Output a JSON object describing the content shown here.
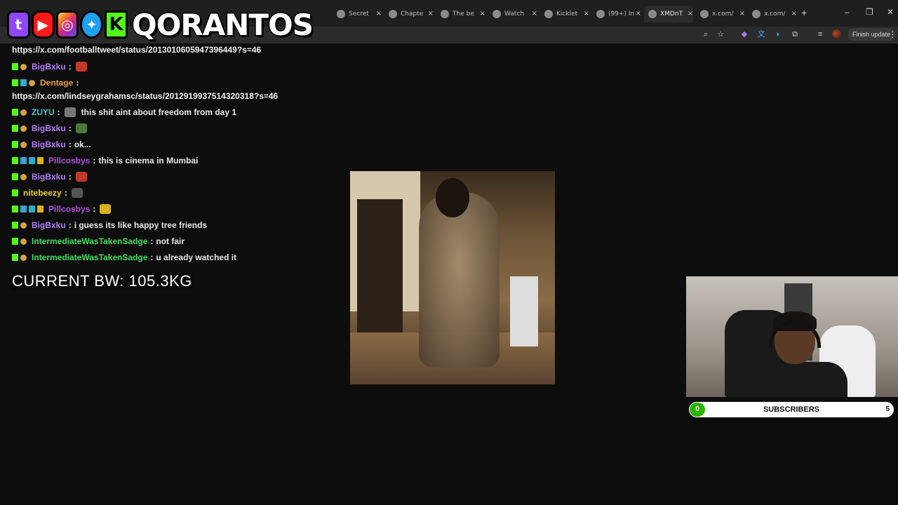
{
  "browser": {
    "tabs": [
      {
        "label": "Secret",
        "icon": "globe-icon"
      },
      {
        "label": "Chapte",
        "icon": "book-icon"
      },
      {
        "label": "The be",
        "icon": "github-icon"
      },
      {
        "label": "Watch",
        "icon": "play-icon"
      },
      {
        "label": "Kicklet",
        "icon": "kick-icon"
      },
      {
        "label": "(99+) In",
        "icon": "tiktok-icon"
      },
      {
        "label": "XMDnT",
        "icon": "frog-icon",
        "active": true
      },
      {
        "label": "x.com/",
        "icon": "x-icon"
      },
      {
        "label": "x.com/",
        "icon": "x-icon"
      }
    ],
    "new_tab": "+",
    "finish_update": "Finish update"
  },
  "overlay": {
    "brand": "QORANTOS",
    "socials": [
      "twitch",
      "youtube",
      "instagram",
      "twitter",
      "kick"
    ]
  },
  "chat": {
    "top_link": "https://x.com/footballtweet/status/2013010605947396449?s=46",
    "lines": [
      {
        "badges": [
          "kick",
          "hand"
        ],
        "user": "BigBxku",
        "color": "#b37ff5",
        "text": "",
        "emote": "#c0392b"
      },
      {
        "badges": [
          "kick",
          "cube",
          "hand"
        ],
        "user": "Dentage",
        "color": "#e8a33a",
        "text": "",
        "emote": ""
      },
      {
        "badges": [
          "kick",
          "hand"
        ],
        "user": "ZUYU",
        "color": "#40c8d0",
        "text": "this shit aint about freedom from day 1",
        "emote": "#777777"
      },
      {
        "badges": [
          "kick",
          "hand"
        ],
        "user": "BigBxku",
        "color": "#b37ff5",
        "text": "",
        "emote": "#4a7a3a"
      },
      {
        "badges": [
          "kick",
          "hand"
        ],
        "user": "BigBxku",
        "color": "#b37ff5",
        "text": "ok...",
        "emote": ""
      },
      {
        "badges": [
          "kick",
          "blue",
          "cube",
          "gold"
        ],
        "user": "Pillcosbys",
        "color": "#b050e0",
        "text": "this is cinema in Mumbai",
        "emote": ""
      },
      {
        "badges": [
          "kick",
          "hand"
        ],
        "user": "BigBxku",
        "color": "#b37ff5",
        "text": "",
        "emote": "#c0392b"
      },
      {
        "badges": [
          "kick"
        ],
        "user": "nitebeezy",
        "color": "#e8d030",
        "text": "",
        "emote": "#555555"
      },
      {
        "badges": [
          "kick",
          "blue",
          "cube",
          "gold"
        ],
        "user": "Pillcosbys",
        "color": "#b050e0",
        "text": "",
        "emote": "#d8b020"
      },
      {
        "badges": [
          "kick",
          "hand"
        ],
        "user": "BigBxku",
        "color": "#b37ff5",
        "text": "i guess its like happy tree friends",
        "emote": ""
      },
      {
        "badges": [
          "kick",
          "hand"
        ],
        "user": "IntermediateWasTakenSadge",
        "color": "#3ee060",
        "text": "not fair",
        "emote": ""
      },
      {
        "badges": [
          "kick",
          "hand"
        ],
        "user": "IntermediateWasTakenSadge",
        "color": "#3ee060",
        "text": "u already watched it",
        "emote": ""
      }
    ],
    "link_after_dentage": "https://x.com/lindseygrahamsc/status/2012919937514320318?s=46"
  },
  "body_weight": "CURRENT BW: 105.3KG",
  "subscribers": {
    "current": "0",
    "label": "SUBSCRIBERS",
    "goal": "5",
    "progress": 0.0,
    "fill_color": "#2db400"
  }
}
